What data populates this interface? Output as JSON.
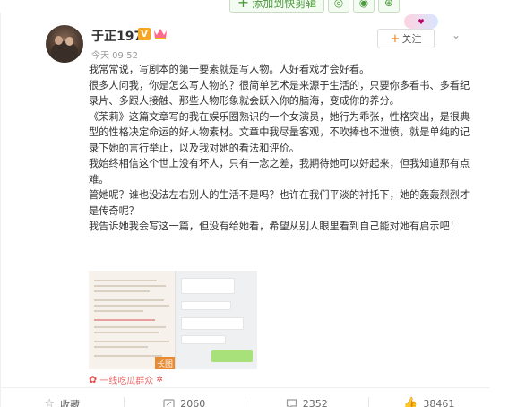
{
  "toolbar": {
    "add_label": "添加到快剪辑"
  },
  "post": {
    "author": "于正1978",
    "verified_badge": "V",
    "timestamp": "今天 09:52",
    "follow_label": "关注",
    "paragraphs": [
      "我常常说，写剧本的第一要素就是写人物。人好看戏才会好看。",
      "很多人问我，你是怎么写人物的？很简单艺术是来源于生活的，只要你多看书、多看纪录片、多跟人接触、那些人物形象就会跃入你的脑海，变成你的养分。",
      "《茉莉》这篇文章写的我在娱乐圈熟识的一个女演员，她行为乖张，性格突出，是很典型的性格决定命运的好人物素材。文章中我尽量客观，不吹捧也不泄愤，就是单纯的记录下她的言行举止，以及我对她的看法和评价。",
      "我始终相信这个世上没有坏人，只有一念之差，我期待她可以好起来，但我知道那有点难。",
      "管她呢？谁也没法左右别人的生活不是吗？也许在我们平淡的衬托下，她的轰轰烈烈才是传奇呢？",
      "我告诉她我会写这一篇，但没有给她看，希望从别人眼里看到自己能对她有启示吧！"
    ],
    "long_image_badge": "长图",
    "source_label": "一线吃瓜群众"
  },
  "actions": {
    "favorite_label": "收藏",
    "repost_count": "2060",
    "comment_count": "2352",
    "like_count": "38461"
  },
  "colors": {
    "accent_orange": "#f57a00",
    "source_red": "#eb6a6a",
    "toolbar_green": "#4a9b3a"
  },
  "icons": {
    "favorite": "star-outline-icon",
    "repost": "repost-icon",
    "comment": "comment-icon",
    "like": "thumb-up-icon"
  }
}
